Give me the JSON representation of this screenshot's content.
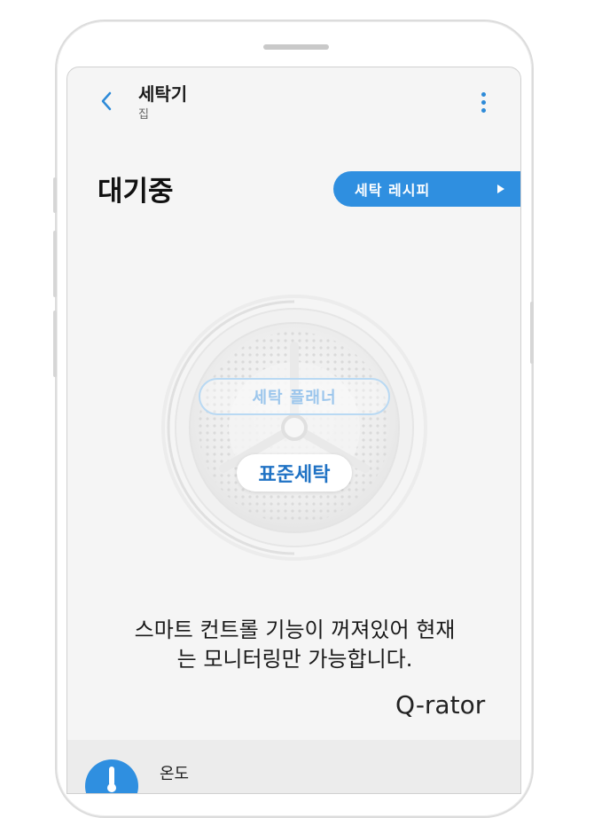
{
  "header": {
    "title": "세탁기",
    "subtitle": "집",
    "back_icon": "chevron-left-icon",
    "menu_icon": "more-vertical-icon"
  },
  "status": {
    "label": "대기중"
  },
  "recipe_button": {
    "label": "세탁 레시피",
    "icon": "play-right-icon"
  },
  "dial": {
    "planner_label": "세탁 플래너",
    "course_label": "표준세탁"
  },
  "message": {
    "line1": "스마트 컨트롤 기능이 꺼져있어 현재",
    "line2": "는 모니터링만 가능합니다."
  },
  "brand": {
    "label": "Q-rator"
  },
  "temperature": {
    "label": "온도",
    "icon": "thermometer-icon"
  },
  "colors": {
    "accent": "#2f8fe0",
    "screen_bg": "#f5f5f5",
    "course_text": "#1f72c4"
  }
}
